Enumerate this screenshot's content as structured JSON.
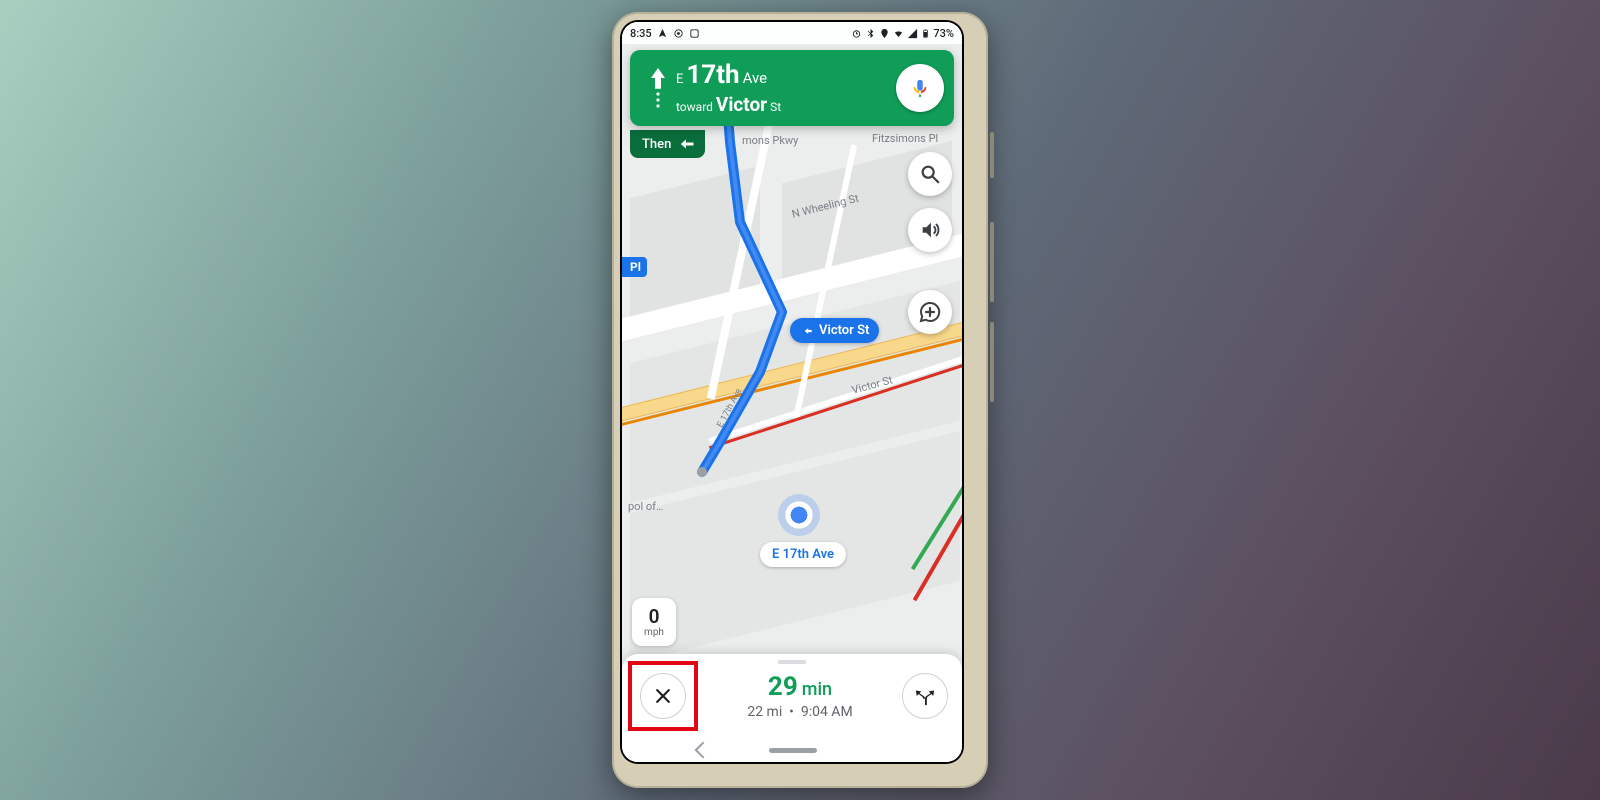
{
  "status": {
    "time": "8:35",
    "battery": "73%"
  },
  "nav": {
    "prefix": "E",
    "road_num": "17th",
    "road_suffix": "Ave",
    "toward_label": "toward",
    "toward_road": "Victor",
    "toward_suffix": "St",
    "then_label": "Then"
  },
  "street_chip": {
    "label": "Victor St"
  },
  "pl_chip": {
    "label": "Pl"
  },
  "current_label": {
    "text": "E 17th Ave"
  },
  "map_labels": {
    "fitzsimons": "Fitzsimons Pl",
    "mons_pkwy": "mons Pkwy",
    "wheeling": "N Wheeling St",
    "victor": "Victor St",
    "e17": "E 17th Ave",
    "pol_of": "pol of…"
  },
  "speed": {
    "value": "0",
    "unit": "mph"
  },
  "eta": {
    "duration_num": "29",
    "duration_unit": "min",
    "distance": "22 mi",
    "arrival": "9:04 AM"
  }
}
